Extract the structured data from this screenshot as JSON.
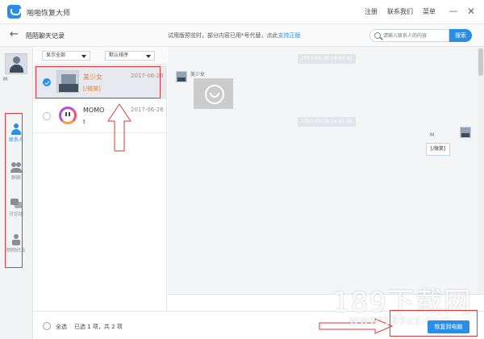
{
  "app": {
    "title": "啪啪恢复大师",
    "links": [
      "注册",
      "联系我们",
      "菜单"
    ],
    "minimize": "—",
    "close": "✕"
  },
  "subbar": {
    "back": "←",
    "title": "陌陌聊天记录",
    "notice": "试用版预览时，部分内容已用*号代替，点此",
    "notice_link": "支持正版",
    "search_placeholder": "请输入联系人的内容",
    "search_button": "搜索"
  },
  "sidebar": {
    "user_name": "M",
    "items": [
      {
        "label": "联系人",
        "icon": "person-icon"
      },
      {
        "label": "群聊",
        "icon": "group-icon"
      },
      {
        "label": "讨论组",
        "icon": "chat-icon"
      },
      {
        "label": "陌陌好友",
        "icon": "friend-icon"
      }
    ]
  },
  "filters": {
    "show": "显示全部",
    "sort": "默认排序"
  },
  "contacts": [
    {
      "name": "美少女",
      "preview": "[/微笑]",
      "date": "2017-06-28",
      "selected": true
    },
    {
      "name": "MOMO",
      "preview": "t",
      "date": "2017-06-26",
      "selected": false
    }
  ],
  "chat": {
    "time1": "2017-06-28 14:43:40",
    "sender": "美少女",
    "time2": "2017-06-28 14:45:30",
    "reply": "[/微笑]",
    "reply_sender": "M"
  },
  "footer": {
    "select_all": "全选",
    "count": "已选 1 项，共 2 项",
    "recover": "恢复到电脑"
  },
  "watermark": {
    "main": "189下载网",
    "sub": "www.189xz.com"
  },
  "colors": {
    "accent": "#2a8ee8",
    "highlight": "#ee7a2c",
    "annotation": "#e23a3a"
  }
}
